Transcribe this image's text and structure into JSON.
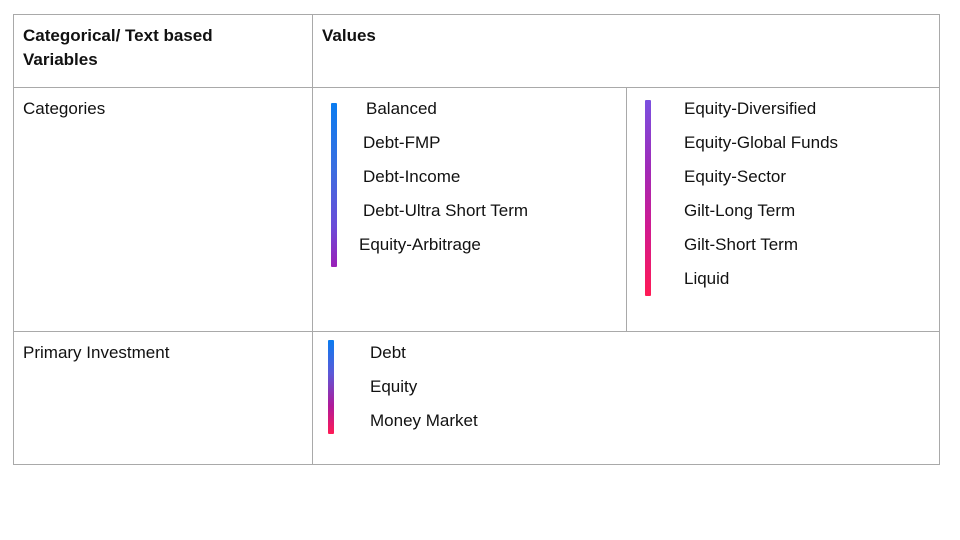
{
  "header": {
    "col1": "Categorical/ Text based Variables",
    "col2": "Values"
  },
  "categories_row": {
    "label": "Categories",
    "left_values": [
      "Balanced",
      "Debt-FMP",
      "Debt-Income",
      "Debt-Ultra Short Term",
      "Equity-Arbitrage"
    ],
    "right_values": [
      "Equity-Diversified",
      "Equity-Global Funds",
      "Equity-Sector",
      "Gilt-Long Term",
      "Gilt-Short Term",
      "Liquid"
    ]
  },
  "primary_row": {
    "label": "Primary Investment",
    "values": [
      "Debt",
      "Equity",
      "Money Market"
    ]
  },
  "colors": {
    "border": "#a9a9a9",
    "gradient_blue": "#0a7cf0",
    "gradient_purple": "#8a2bd0",
    "gradient_pink": "#ff1a55"
  }
}
